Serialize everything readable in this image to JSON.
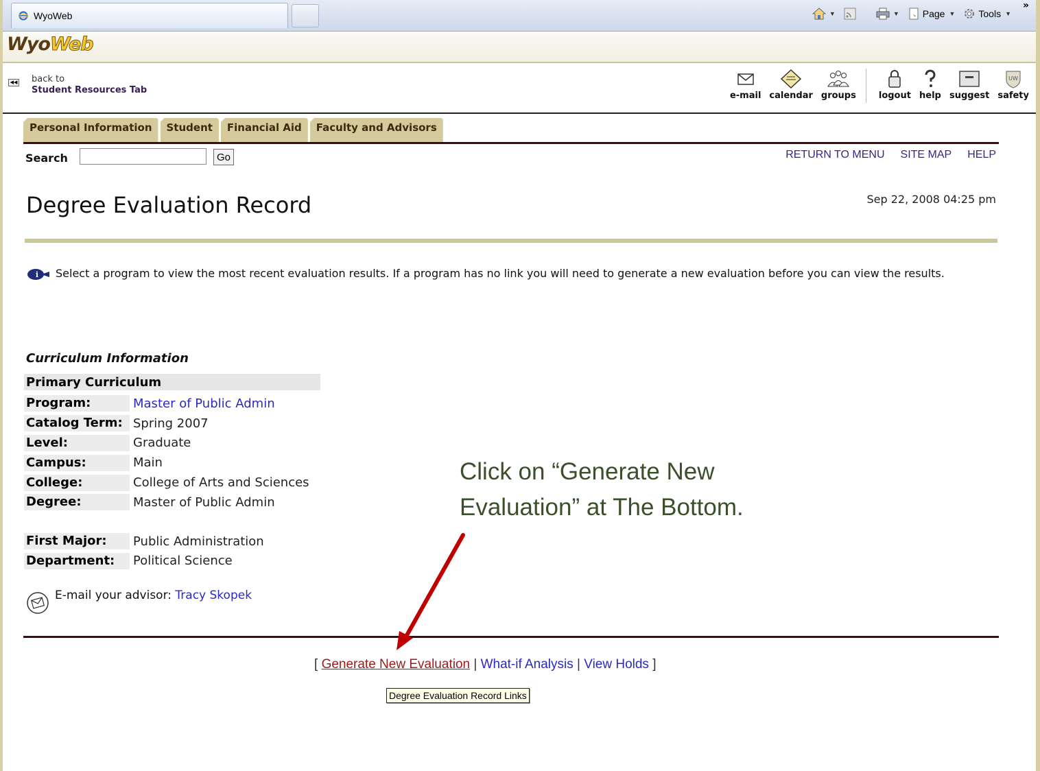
{
  "browser": {
    "tab_title": "WyoWeb",
    "page_label": "Page",
    "tools_label": "Tools",
    "chevron": "»"
  },
  "logo": {
    "part1": "Wyo",
    "part2": "Web"
  },
  "back": {
    "line1": "back to",
    "line2": "Student Resources Tab"
  },
  "nav_icons": [
    {
      "label": "e-mail",
      "icon": "envelope-icon"
    },
    {
      "label": "calendar",
      "icon": "calendar-icon"
    },
    {
      "label": "groups",
      "icon": "groups-icon"
    },
    {
      "label": "logout",
      "icon": "lock-icon"
    },
    {
      "label": "help",
      "icon": "question-icon"
    },
    {
      "label": "suggest",
      "icon": "suggestion-box-icon"
    },
    {
      "label": "safety",
      "icon": "safety-shield-icon"
    }
  ],
  "tabs": [
    "Personal Information",
    "Student",
    "Financial Aid",
    "Faculty and Advisors"
  ],
  "search": {
    "label": "Search",
    "value": "",
    "go": "Go"
  },
  "top_links": [
    "RETURN TO MENU",
    "SITE MAP",
    "HELP"
  ],
  "page_title": "Degree Evaluation Record",
  "timestamp": "Sep 22, 2008 04:25 pm",
  "info_text": "Select a program to view the most recent evaluation results. If a program has no link you will need to generate a new evaluation before you can view the results.",
  "curriculum": {
    "heading": "Curriculum Information",
    "primary": "Primary Curriculum",
    "rows": [
      {
        "label": "Program:",
        "value": "Master of Public Admin",
        "link": true
      },
      {
        "label": "Catalog Term:",
        "value": "Spring 2007"
      },
      {
        "label": "Level:",
        "value": "Graduate"
      },
      {
        "label": "Campus:",
        "value": "Main"
      },
      {
        "label": "College:",
        "value": "College of Arts and Sciences"
      },
      {
        "label": "Degree:",
        "value": "Master of Public Admin"
      }
    ],
    "rows2": [
      {
        "label": "First Major:",
        "value": "Public Administration"
      },
      {
        "label": "Department:",
        "value": "Political Science"
      }
    ]
  },
  "advisor": {
    "prefix": "E-mail your advisor: ",
    "name": "Tracy Skopek"
  },
  "bottom_links": {
    "open": "[ ",
    "generate": "Generate New Evaluation",
    "sep": " | ",
    "whatif": "What-if Analysis",
    "holds": "View Holds",
    "close": " ]"
  },
  "tooltip": "Degree Evaluation Record Links",
  "callout": {
    "line1": "Click on “Generate New",
    "line2": "Evaluation” at The Bottom."
  },
  "colors": {
    "tab_bg": "#d5ca9b",
    "rule": "#3a0d10",
    "link": "#2a2ac0",
    "callout": "#3b4f2b",
    "arrow": "#c00000"
  }
}
